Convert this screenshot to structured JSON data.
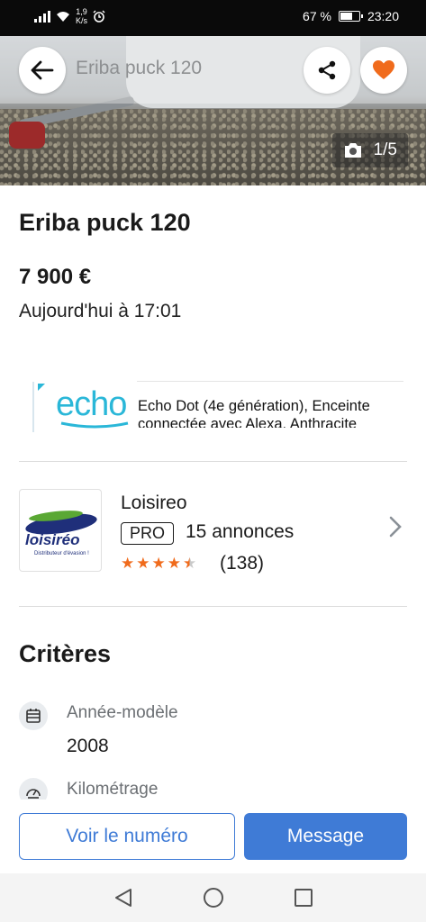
{
  "status_bar": {
    "network_speed": "1,9\nK/s",
    "battery": "67 %",
    "battery_level": 0.67,
    "time": "23:20"
  },
  "header": {
    "title": "Eriba puck 120",
    "photo_counter": "1/5"
  },
  "listing": {
    "title": "Eriba puck 120",
    "price": "7 900 €",
    "date": "Aujourd'hui à 17:01"
  },
  "ad": {
    "brand": "echo",
    "text": "Echo Dot (4e génération), Enceinte connectée avec Alexa, Anthracite"
  },
  "seller": {
    "name": "Loisireo",
    "logo_text": "loisiréo",
    "logo_tagline": "Distributeur d'évasion !",
    "badge": "PRO",
    "listings": "15 annonces",
    "rating": 4.5,
    "rating_count": "(138)"
  },
  "criteria": {
    "title": "Critères",
    "items": [
      {
        "label": "Année-modèle",
        "value": "2008",
        "icon": "calendar-icon"
      },
      {
        "label": "Kilométrage",
        "value": "",
        "icon": "speedometer-icon"
      }
    ]
  },
  "actions": {
    "call_label": "Voir le numéro",
    "message_label": "Message"
  },
  "colors": {
    "accent": "#3f7bd6",
    "favorite": "#f06b1c",
    "star": "#f06b1c"
  }
}
